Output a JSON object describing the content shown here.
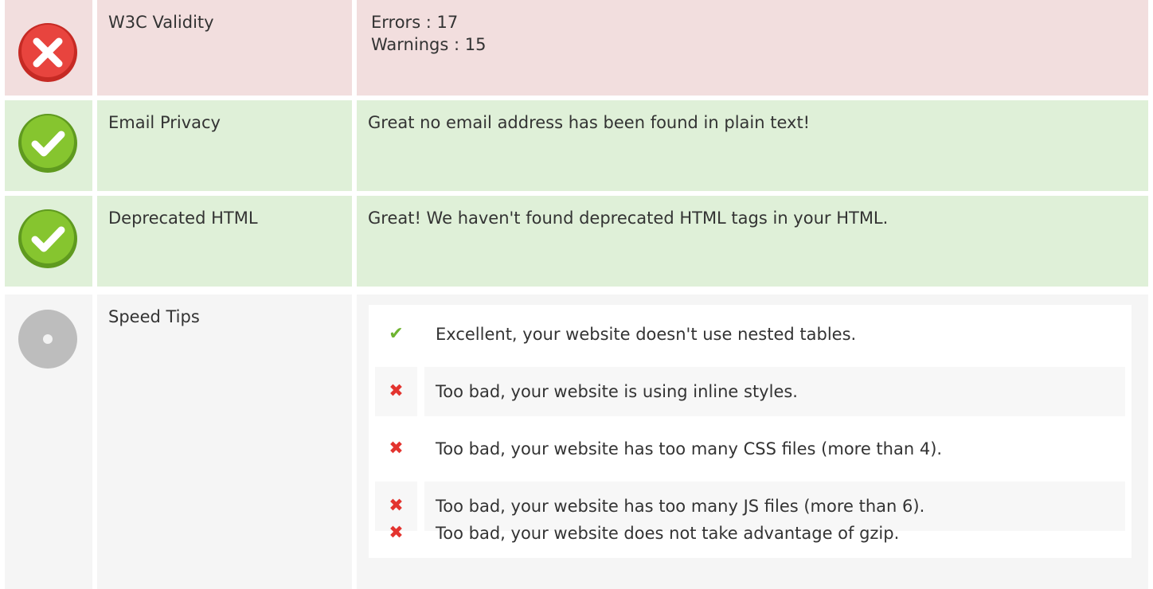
{
  "rows": [
    {
      "status": "error",
      "icon": "error-x-icon",
      "label": "W3C Validity",
      "lines": [
        "Errors : 17",
        "Warnings : 15"
      ]
    },
    {
      "status": "success",
      "icon": "success-check-icon",
      "label": "Email Privacy",
      "text": "Great no email address has been found in plain text!"
    },
    {
      "status": "success",
      "icon": "success-check-icon",
      "label": "Deprecated HTML",
      "text": "Great! We haven't found deprecated HTML tags in your HTML."
    },
    {
      "status": "neutral",
      "icon": "neutral-dot-icon",
      "label": "Speed Tips",
      "tips": [
        {
          "status": "pass",
          "icon": "check-icon",
          "text": "Excellent, your website doesn't use nested tables."
        },
        {
          "status": "fail",
          "icon": "x-icon",
          "text": "Too bad, your website is using inline styles."
        },
        {
          "status": "fail",
          "icon": "x-icon",
          "text": "Too bad, your website has too many CSS files (more than 4)."
        },
        {
          "status": "fail",
          "icon": "x-icon",
          "text": "Too bad, your website has too many JS files (more than 6)."
        },
        {
          "status": "fail",
          "icon": "x-icon",
          "text": "Too bad, your website does not take advantage of gzip."
        }
      ]
    }
  ],
  "colors": {
    "error_bg": "#f2dede",
    "success_bg": "#dff0d8",
    "neutral_bg": "#f5f5f5",
    "error_icon": "#e3342f",
    "success_icon": "#7cc22d",
    "neutral_icon": "#bdbdbd"
  }
}
